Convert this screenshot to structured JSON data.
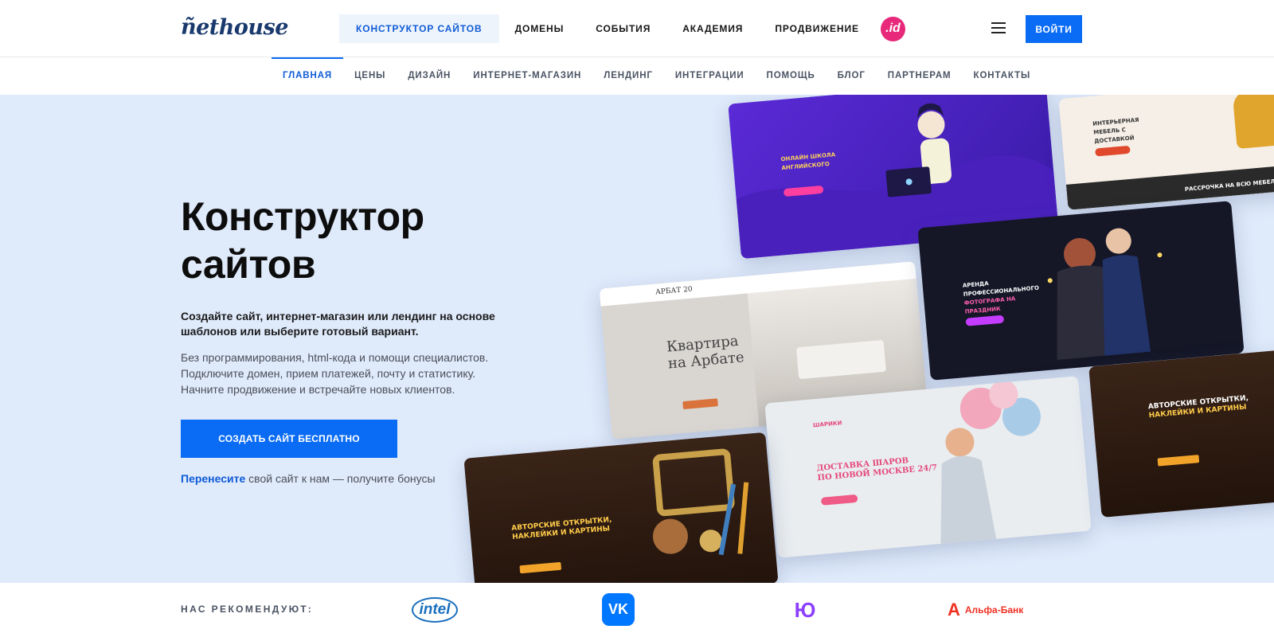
{
  "header": {
    "logo": "ñethouse",
    "nav": [
      "КОНСТРУКТОР САЙТОВ",
      "ДОМЕНЫ",
      "СОБЫТИЯ",
      "АКАДЕМИЯ",
      "ПРОДВИЖЕНИЕ"
    ],
    "id_logo": ".id",
    "login_label": "ВОЙТИ"
  },
  "subnav": {
    "items": [
      "ГЛАВНАЯ",
      "ЦЕНЫ",
      "ДИЗАЙН",
      "ИНТЕРНЕТ-МАГАЗИН",
      "ЛЕНДИНГ",
      "ИНТЕГРАЦИИ",
      "ПОМОЩЬ",
      "БЛОГ",
      "ПАРТНЕРАМ",
      "КОНТАКТЫ"
    ],
    "active": "ГЛАВНАЯ"
  },
  "hero": {
    "title_line1": "Конструктор",
    "title_line2": "сайтов",
    "lead": "Создайте сайт, интернет-магазин или лендинг на основе шаблонов или выберите готовый вариант.",
    "desc_line1": "Без программирования, html-кода и помощи специалистов.",
    "desc_line2": "Подключите домен, прием платежей, почту и статистику.",
    "desc_line3": "Начните продвижение и встречайте новых клиентов.",
    "cta_label": "СОЗДАТЬ САЙТ БЕСПЛАТНО",
    "transfer_link": "Перенесите",
    "transfer_rest": " свой сайт к нам — получите бонусы"
  },
  "templates": {
    "arbat_brand": "АРБАТ 20",
    "arbat_title_1": "Квартира",
    "arbat_title_2": "на Арбате",
    "cards_title": "АВТОРСКИЕ ОТКРЫТКИ,",
    "cards_title_2": "НАКЛЕЙКИ И КАРТИНЫ",
    "balloons_title": "ДОСТАВКА ШАРОВ",
    "balloons_title_2": "ПО НОВОЙ МОСКВЕ 24/7",
    "balloons_brand": "ШАРИКИ",
    "furniture_title": "ИНТЕРЬЕРНАЯ МЕБЕЛЬ С ДОСТАВКОЙ",
    "furniture_footer": "РАССРОЧКА НА ВСЮ МЕБЕЛЬ БЕЗ%",
    "lang_title": "ОНЛАЙН ШКОЛА АНГЛИЙСКОГО",
    "wolf_title": "АРЕНДА ПРОФЕССИОНАЛЬНОГО",
    "wolf_title_2": "ФОТОГРАФА НА ПРАЗДНИК"
  },
  "recommend": {
    "label": "НАС РЕКОМЕНДУЮТ:",
    "partners": [
      "intel",
      "VK",
      "Ю",
      "А",
      "Альфа-Банк"
    ]
  },
  "colors": {
    "accent": "#0a6cf5",
    "hero_bg": "#dfeafb",
    "logo": "#1a3a6e",
    "id_pink": "#e8287a",
    "alfa_red": "#ef3124",
    "yoo_purple": "#8b3ffd"
  }
}
